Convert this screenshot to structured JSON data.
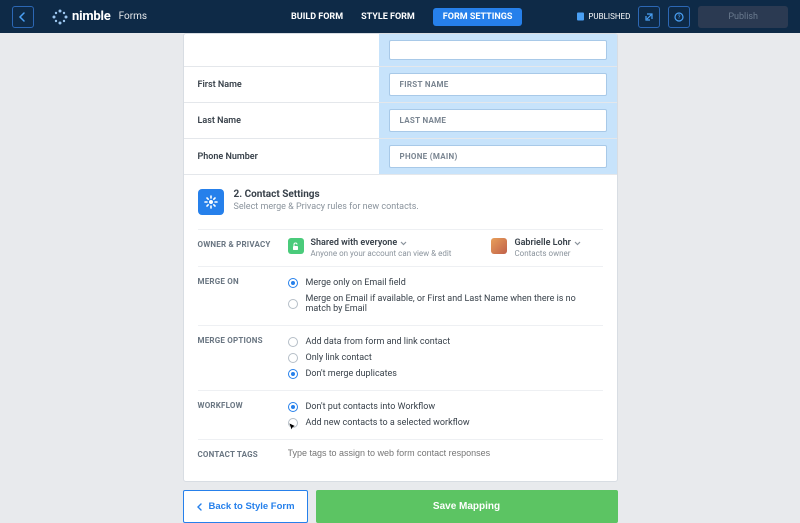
{
  "brand": {
    "name": "nimble",
    "product": "Forms"
  },
  "tabs": {
    "build": "BUILD FORM",
    "style": "STYLE FORM",
    "settings": "FORM SETTINGS",
    "active": "settings"
  },
  "status": "PUBLISHED",
  "publish_btn": "Publish",
  "mapping": {
    "rows": [
      {
        "label": "First Name",
        "field": "FIRST NAME"
      },
      {
        "label": "Last Name",
        "field": "LAST NAME"
      },
      {
        "label": "Phone Number",
        "field": "PHONE (MAIN)"
      }
    ]
  },
  "section": {
    "title": "2. Contact Settings",
    "sub": "Select merge & Privacy rules for new contacts."
  },
  "owner": {
    "label": "OWNER & PRIVACY",
    "share": {
      "title": "Shared with everyone",
      "sub": "Anyone on your account can view & edit"
    },
    "person": {
      "name": "Gabrielle Lohr",
      "sub": "Contacts owner"
    }
  },
  "merge_on": {
    "label": "MERGE ON",
    "opts": [
      "Merge only on Email field",
      "Merge on Email if available, or First and Last Name when there is no match by Email"
    ],
    "sel": 0
  },
  "merge_options": {
    "label": "MERGE OPTIONS",
    "opts": [
      "Add data from form and link contact",
      "Only link contact",
      "Don't merge duplicates"
    ],
    "sel": 2
  },
  "workflow": {
    "label": "WORKFLOW",
    "opts": [
      "Don't put contacts into Workflow",
      "Add new contacts to a selected workflow"
    ],
    "sel": 0
  },
  "tags": {
    "label": "CONTACT TAGS",
    "placeholder": "Type tags to assign to web form contact responses"
  },
  "footer": {
    "back": "Back to Style Form",
    "save": "Save Mapping"
  }
}
